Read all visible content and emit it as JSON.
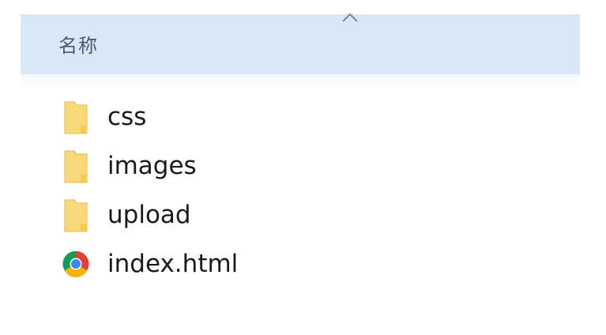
{
  "header": {
    "column_name": "名称",
    "sort_icon": "sort-ascending-icon"
  },
  "files": [
    {
      "name": "css",
      "icon": "folder-icon"
    },
    {
      "name": "images",
      "icon": "folder-icon"
    },
    {
      "name": "upload",
      "icon": "folder-icon"
    },
    {
      "name": "index.html",
      "icon": "chrome-html-icon"
    }
  ],
  "colors": {
    "header_bg": "#d9e8f6",
    "folder_yellow": "#f7d97a",
    "text": "#1a1a1a"
  }
}
